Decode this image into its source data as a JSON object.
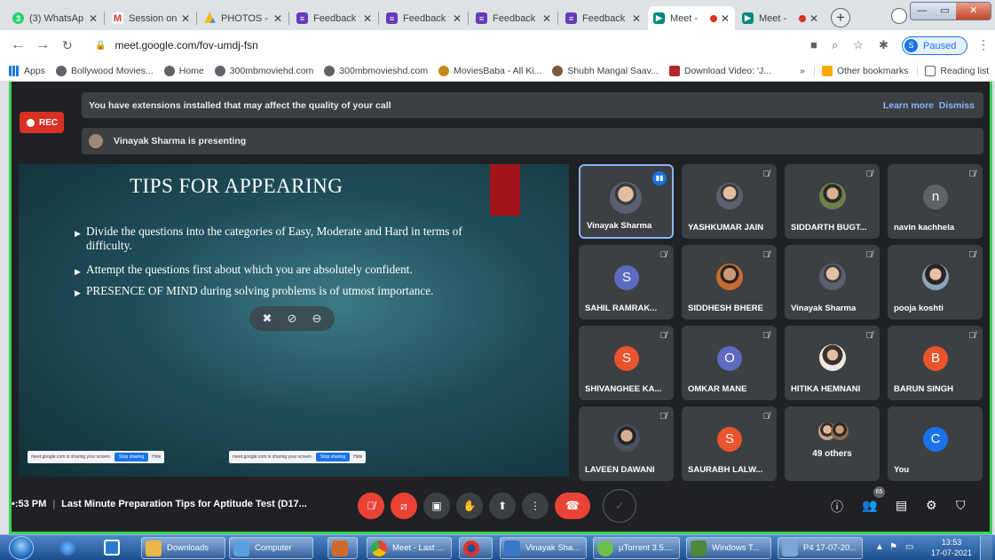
{
  "browser": {
    "tabs": [
      {
        "label": "(3) WhatsAp",
        "icon": "whatsapp-icon",
        "color": "#25d366"
      },
      {
        "label": "Session on",
        "icon": "gmail-icon",
        "color": "#d93025"
      },
      {
        "label": "PHOTOS -",
        "icon": "drive-icon",
        "color": "#fbbc04"
      },
      {
        "label": "Feedback fo",
        "icon": "forms-icon",
        "color": "#673ab7"
      },
      {
        "label": "Feedback fo",
        "icon": "forms-icon",
        "color": "#673ab7"
      },
      {
        "label": "Feedback F",
        "icon": "forms-icon",
        "color": "#673ab7"
      },
      {
        "label": "Feedback F",
        "icon": "forms-icon",
        "color": "#673ab7"
      },
      {
        "label": "Meet -",
        "icon": "meet-icon",
        "color": "#00897b"
      },
      {
        "label": "Meet -",
        "icon": "meet-icon",
        "color": "#00897b"
      }
    ],
    "url": "meet.google.com/fov-umdj-fsn",
    "profile_initial": "S",
    "profile_status": "Paused",
    "bookmarks": [
      {
        "label": "Apps",
        "icon": "apps-grid-icon",
        "color": "#1a73e8"
      },
      {
        "label": "Bollywood Movies...",
        "icon": "globe-icon",
        "color": "#5f6368"
      },
      {
        "label": "Home",
        "icon": "globe-icon",
        "color": "#5f6368"
      },
      {
        "label": "300mbmoviehd.com",
        "icon": "globe-icon",
        "color": "#5f6368"
      },
      {
        "label": "300mbmovieshd.com",
        "icon": "globe-icon",
        "color": "#5f6368"
      },
      {
        "label": "MoviesBaba - All Ki...",
        "icon": "moviesbaba-icon",
        "color": "#c58a1a"
      },
      {
        "label": "Shubh Mangal Saav...",
        "icon": "site-icon",
        "color": "#7a5a3a"
      },
      {
        "label": "Download Video: 'J...",
        "icon": "site-icon",
        "color": "#b3262c"
      }
    ],
    "more_bookmarks": "»",
    "other_bookmarks": "Other bookmarks",
    "reading_list": "Reading list"
  },
  "meet": {
    "banner_text": "You have extensions installed that may affect the quality of your call",
    "learn_more": "Learn more",
    "dismiss": "Dismiss",
    "rec_label": "REC",
    "presenting_text": "Vinayak Sharma is presenting",
    "slide": {
      "title": "TIPS FOR APPEARING",
      "bullets": [
        "Divide the questions into the categories of Easy, Moderate and Hard in terms of difficulty.",
        "Attempt the questions first about which you are absolutely confident.",
        "PRESENCE OF MIND during solving problems is of utmost importance."
      ],
      "share_notice": "meet.google.com is sharing your screen.",
      "stop_sharing": "Stop sharing",
      "hide": "Hide"
    },
    "participants": [
      {
        "name": "Vinayak Sharma",
        "kind": "photo",
        "speaking": true
      },
      {
        "name": "YASHKUMAR JAIN",
        "kind": "photo"
      },
      {
        "name": "SIDDARTH BUGT...",
        "kind": "photo"
      },
      {
        "name": "navin kachhela",
        "kind": "letter",
        "letter": "n",
        "color": "#5f6368"
      },
      {
        "name": "SAHIL RAMRAK...",
        "kind": "letter",
        "letter": "S",
        "color": "#5c6bc0"
      },
      {
        "name": "SIDDHESH BHERE",
        "kind": "photo"
      },
      {
        "name": "Vinayak Sharma",
        "kind": "photo"
      },
      {
        "name": "pooja koshti",
        "kind": "photo"
      },
      {
        "name": "SHIVANGHEE KA...",
        "kind": "letter",
        "letter": "S",
        "color": "#e8542b"
      },
      {
        "name": "OMKAR MANE",
        "kind": "letter",
        "letter": "O",
        "color": "#5c6bc0"
      },
      {
        "name": "HITIKA HEMNANI",
        "kind": "photo"
      },
      {
        "name": "BARUN SINGH",
        "kind": "letter",
        "letter": "B",
        "color": "#e8542b"
      },
      {
        "name": "LAVEEN DAWANI",
        "kind": "photo"
      },
      {
        "name": "SAURABH LALW...",
        "kind": "letter",
        "letter": "S",
        "color": "#e8542b"
      },
      {
        "name": "49 others",
        "kind": "others"
      },
      {
        "name": "You",
        "kind": "letter",
        "letter": "C",
        "color": "#1a73e8"
      }
    ],
    "time": "•:53 PM",
    "meeting_title": "Last Minute Preparation Tips for Aptitude Test (D17...",
    "participant_count": "65"
  },
  "taskbar": {
    "items": [
      {
        "label": "Downloads",
        "color": "#e8b64a"
      },
      {
        "label": "Computer",
        "color": "#5aa0e0"
      },
      {
        "label": "",
        "color": "#d06a2a"
      },
      {
        "label": "Meet - Last ...",
        "color": "#e94235"
      },
      {
        "label": "",
        "color": "#e0302a"
      },
      {
        "label": "Vinayak Sha...",
        "color": "#3b78c8"
      },
      {
        "label": "µTorrent 3.5....",
        "color": "#6cc04a"
      },
      {
        "label": "Windows T...",
        "color": "#4a8a3a"
      },
      {
        "label": "P4 17-07-20...",
        "color": "#7aa6d8"
      }
    ],
    "time": "13:53",
    "date": "17-07-2021"
  }
}
